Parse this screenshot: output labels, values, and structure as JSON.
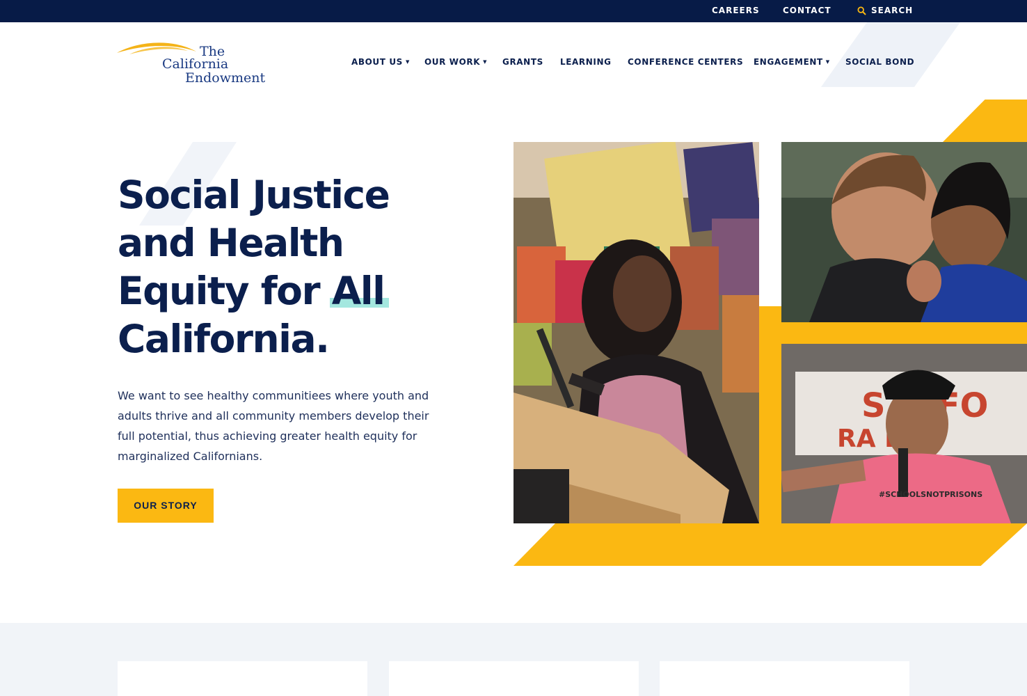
{
  "topbar": {
    "careers": "CAREERS",
    "contact": "CONTACT",
    "search": "SEARCH"
  },
  "logo": {
    "line1": "The",
    "line2": "California",
    "line3": "Endowment"
  },
  "nav": {
    "about": "ABOUT US",
    "our_work": "OUR WORK",
    "grants": "GRANTS",
    "learning": "LEARNING",
    "conference_centers": "CONFERENCE CENTERS",
    "engagement": "ENGAGEMENT",
    "social_bond": "SOCIAL BOND"
  },
  "hero": {
    "headline_line1": "Social Justice",
    "headline_line2": "and Health",
    "headline_line3_a": "Equity for ",
    "headline_line3_b": "All",
    "headline_line4": "California.",
    "body": "We want to see healthy communitiees where youth and adults thrive and all community members develop their full potential, thus achieving greater health equity for marginalized Californians.",
    "cta": "OUR STORY"
  },
  "icons": {
    "search": "search-icon",
    "caret": "caret-down-icon"
  },
  "colors": {
    "navy": "#071b47",
    "heading": "#0b1f4d",
    "accent_yellow": "#fbb812",
    "highlight_teal": "#a4e7df",
    "section_bg": "#f1f4f8"
  }
}
